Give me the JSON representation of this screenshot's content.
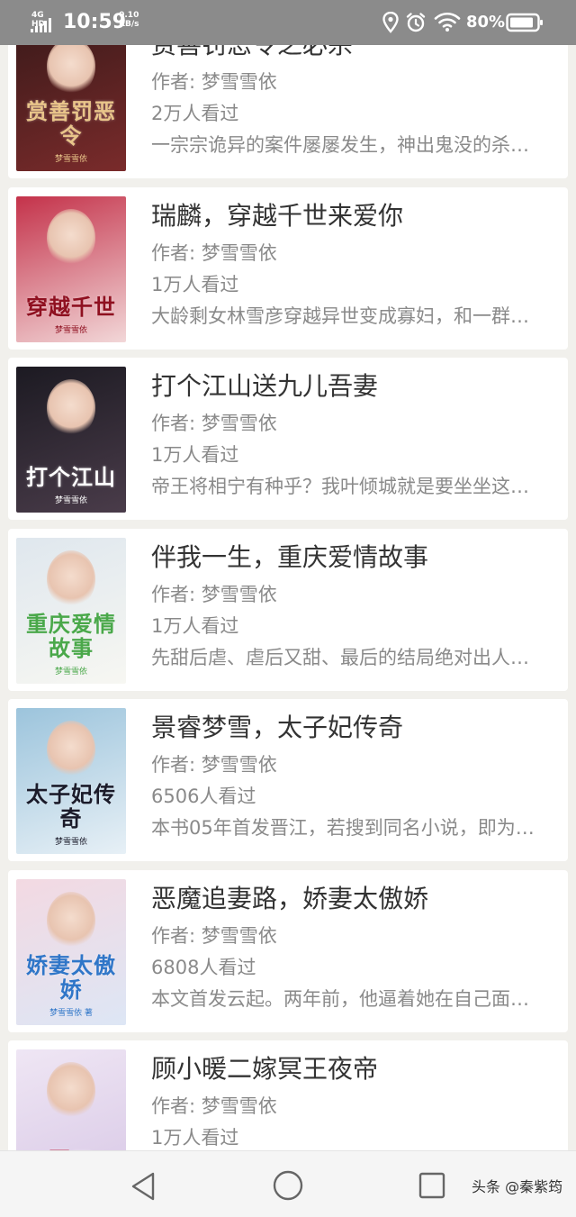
{
  "status_bar": {
    "network": "4G HD",
    "time": "10:59",
    "speed_value": "0.10",
    "speed_unit": "KB/s",
    "battery": "80%",
    "icons": [
      "signal-icon",
      "location-icon",
      "alarm-icon",
      "wifi-icon",
      "battery-icon"
    ]
  },
  "books": [
    {
      "title": "赏善罚恶令之必杀",
      "author": "作者: 梦雪雪依",
      "readers": "2万人看过",
      "description": "一宗宗诡异的案件屡屡发生，神出鬼没的杀手留下一块块…",
      "cover_text": "赏善罚恶令",
      "cover_author": "梦雪雪依",
      "cover_colors": [
        "#3c1a1a",
        "#7a2b2b"
      ],
      "cover_text_color": "#e9c58a"
    },
    {
      "title": "瑞麟，穿越千世来爱你",
      "author": "作者: 梦雪雪依",
      "readers": "1万人看过",
      "description": "大龄剩女林雪彦穿越异世变成寡妇，和一群美男纠缠不清…",
      "cover_text": "穿越千世",
      "cover_author": "梦雪雪依",
      "cover_colors": [
        "#c4324a",
        "#f2d7d8"
      ],
      "cover_text_color": "#8f1020"
    },
    {
      "title": "打个江山送九儿吾妻",
      "author": "作者: 梦雪雪依",
      "readers": "1万人看过",
      "description": "帝王将相宁有种乎？我叶倾城就是要坐坐这江山宝座…",
      "cover_text": "打个江山",
      "cover_author": "梦雪雪依",
      "cover_colors": [
        "#1c1a22",
        "#4a3c4a"
      ],
      "cover_text_color": "#ffffff"
    },
    {
      "title": "伴我一生，重庆爱情故事",
      "author": "作者: 梦雪雪依",
      "readers": "1万人看过",
      "description": "先甜后虐、虐后又甜、最后的结局绝对出人意料…",
      "cover_text": "重庆爱情故事",
      "cover_author": "梦雪雪依",
      "cover_colors": [
        "#dfe7ee",
        "#f7f7f2"
      ],
      "cover_text_color": "#4aa84a"
    },
    {
      "title": "景睿梦雪，太子妃传奇",
      "author": "作者: 梦雪雪依",
      "readers": "6506人看过",
      "description": "本书05年首发晋江，若搜到同名小说，即为本人所著…",
      "cover_text": "太子妃传奇",
      "cover_author": "梦雪雪依",
      "cover_colors": [
        "#9cc4dc",
        "#e7f0f6"
      ],
      "cover_text_color": "#1b1b2a"
    },
    {
      "title": "恶魔追妻路，娇妻太傲娇",
      "author": "作者: 梦雪雪依",
      "readers": "6808人看过",
      "description": "本文首发云起。两年前，他逼着她在自己面前跳楼…",
      "cover_text": "娇妻太傲娇",
      "cover_author": "梦雪雪依 著",
      "cover_colors": [
        "#f3d9e2",
        "#dde6f5"
      ],
      "cover_text_color": "#2f76c8"
    },
    {
      "title": "顾小暖二嫁冥王夜帝",
      "author": "作者: 梦雪雪依",
      "readers": "1万人看过",
      "description": "",
      "cover_text": "冥王",
      "cover_author": "",
      "cover_colors": [
        "#efe6f4",
        "#d8c8e6"
      ],
      "cover_text_color": "#c02a4a"
    }
  ],
  "nav_bar": {
    "icons": [
      "back-icon",
      "home-icon",
      "recent-apps-icon"
    ],
    "watermark": "头条 @秦紫筠"
  },
  "colors": {
    "status_bar_bg": "#8b8b8b",
    "page_bg": "#f1f0ec",
    "title_text": "#333333",
    "meta_text": "#8a8a8a"
  }
}
